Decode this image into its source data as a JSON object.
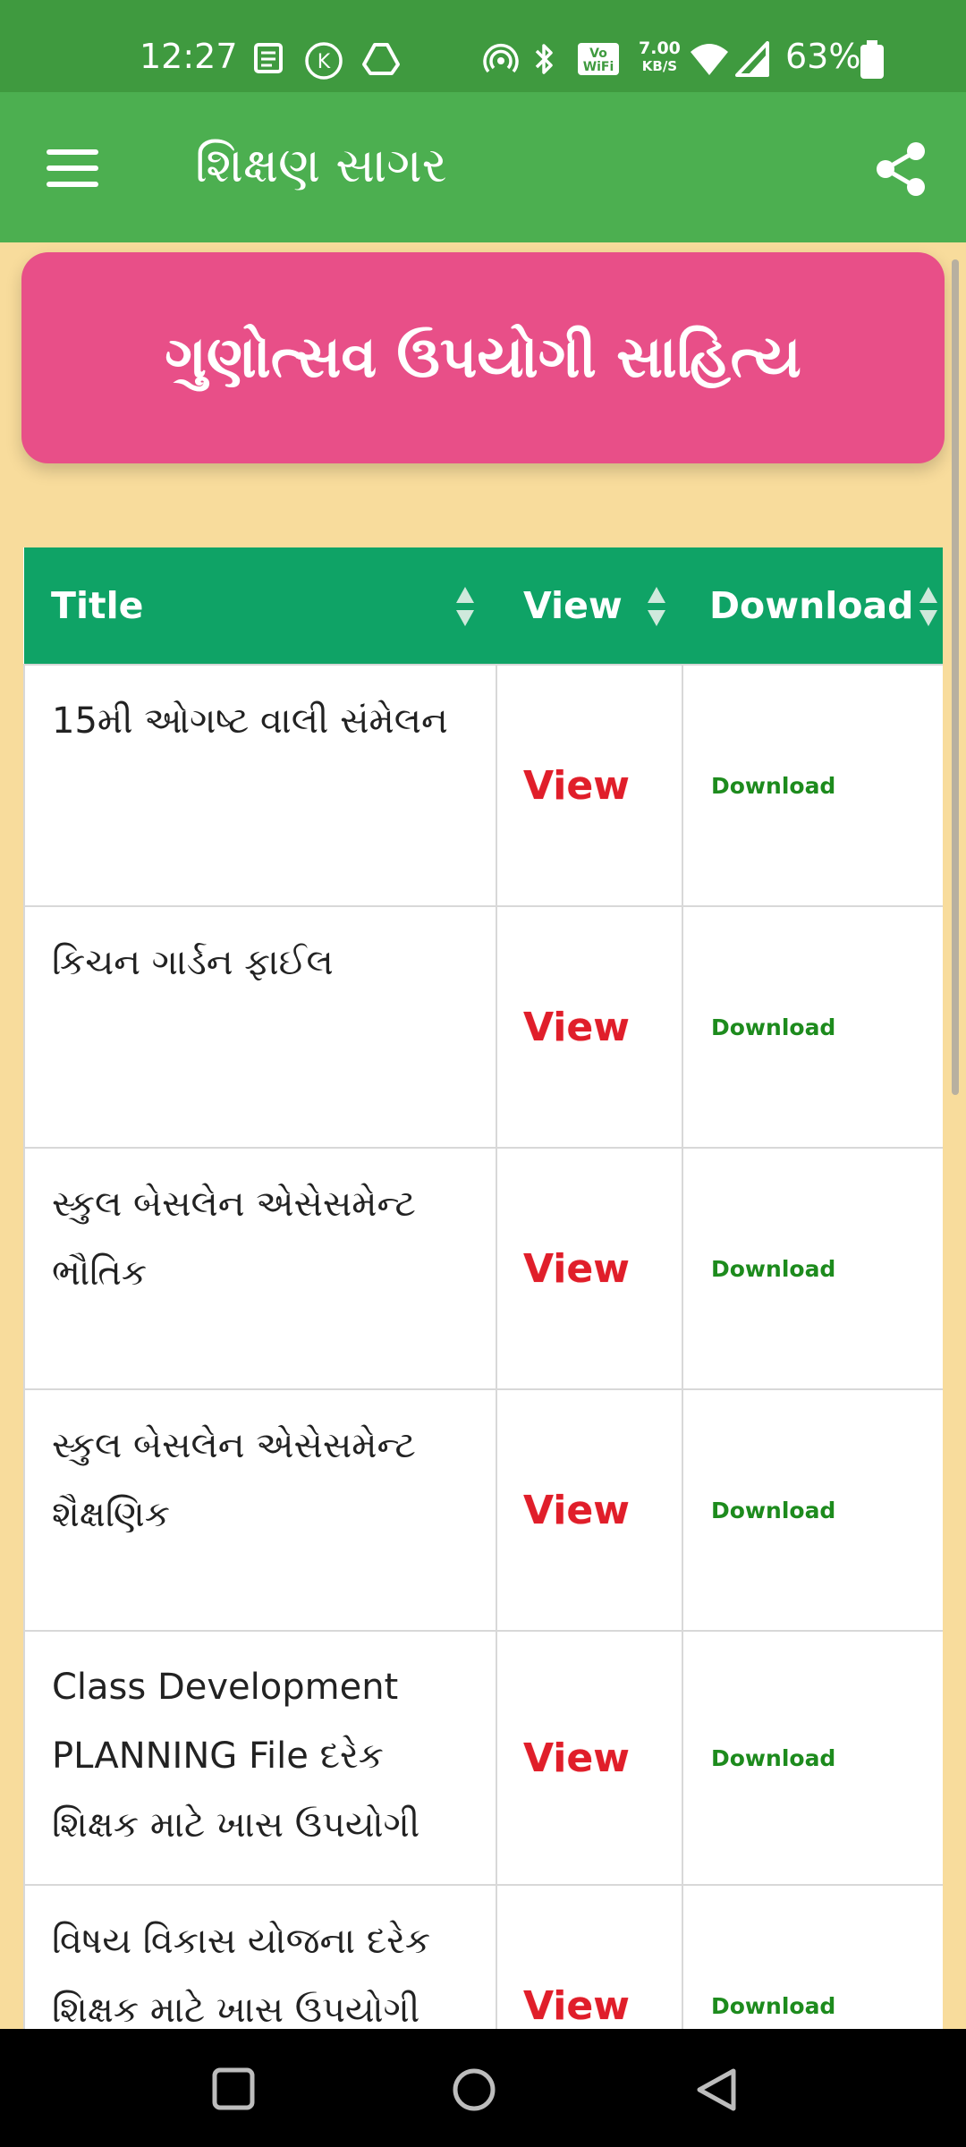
{
  "status_bar": {
    "time": "12:27",
    "speed_value": "7.00",
    "speed_unit": "KB/S",
    "battery": "63%",
    "icons": [
      "news-icon",
      "k-icon",
      "drive-icon",
      "hotspot-icon",
      "bluetooth-icon",
      "vowifi-icon",
      "wifi-icon",
      "signal-icon",
      "battery-icon"
    ]
  },
  "app_bar": {
    "title": "શિક્ષણ સાગર",
    "menu_icon": "hamburger-menu-icon",
    "share_icon": "share-icon",
    "color": "#4caf50"
  },
  "banner": {
    "text": "ગુણોત્સવ ઉપયોગી સાહિત્ય",
    "color": "#e84f88"
  },
  "table": {
    "headers": [
      "Title",
      "View",
      "Download"
    ],
    "header_color": "#0fa366",
    "rows": [
      {
        "title": "15મી ઓગષ્ટ વાલી સંમેલન",
        "view": "View",
        "download": "Download"
      },
      {
        "title": "કિચન ગાર્ડન ફાઈલ",
        "view": "View",
        "download": "Download"
      },
      {
        "title": "સ્કુલ બેસલેન એસેસમેન્ટ ભૌતિક",
        "view": "View",
        "download": "Download"
      },
      {
        "title": "સ્કુલ બેસલેન એસેસમેન્ટ શૈક્ષણિક",
        "view": "View",
        "download": "Download"
      },
      {
        "title": "Class Development PLANNING File દરેક શિક્ષક માટે ખાસ ઉપયોગી",
        "view": "View",
        "download": "Download"
      },
      {
        "title": "વિષય વિકાસ યોજના દરેક શિક્ષક માટે ખાસ ઉપયોગી",
        "view": "View",
        "download": "Download"
      }
    ]
  },
  "nav_bar": {
    "icons": [
      "recents-square-icon",
      "home-circle-icon",
      "back-triangle-icon"
    ]
  }
}
